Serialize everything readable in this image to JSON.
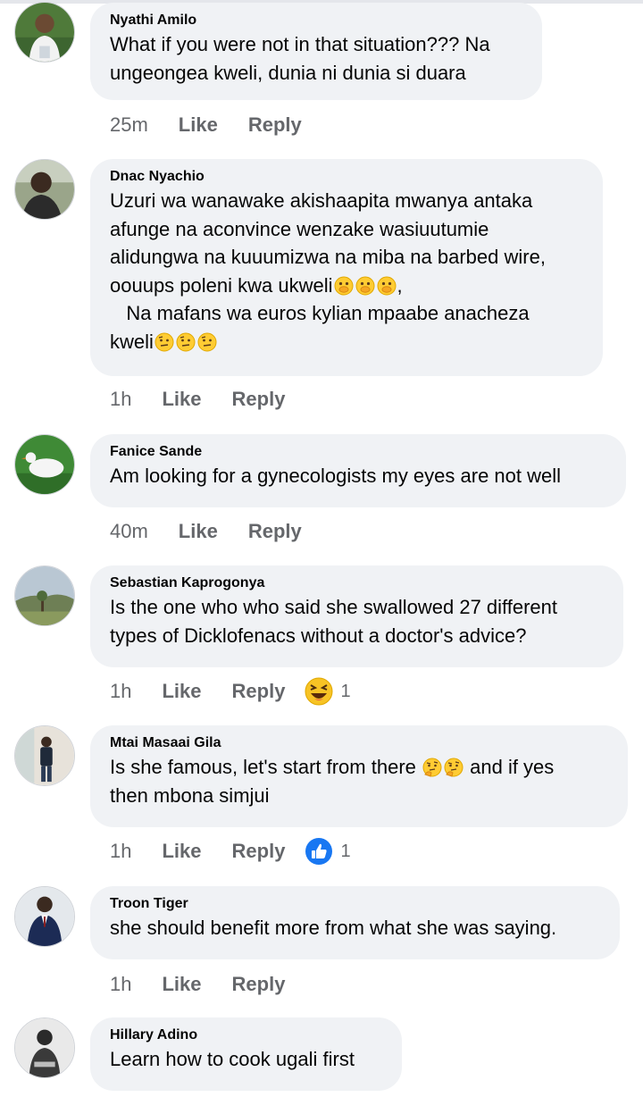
{
  "colors": {
    "bubble": "#f0f2f5",
    "meta_text": "#65676b",
    "like_blue": "#1877f2"
  },
  "comments": [
    {
      "name": "Nyathi Amilo",
      "text": "What if you were not in that situation??? Na\nungeongea kweli, dunia ni dunia si duara",
      "time": "25m",
      "like": "Like",
      "reply": "Reply",
      "avatar_icon": "child-photo-avatar"
    },
    {
      "name": "Dnac Nyachio",
      "text_lines": [
        "Uzuri wa wanawake akishaapita mwanya antaka",
        "afunge na aconvince wenzake wasiuutumie",
        "alidungwa na kuuumizwa na miba na barbed wire,",
        "oouups poleni kwa ukweli",
        "   Na mafans wa euros kylian mpaabe anacheza",
        "kweli"
      ],
      "line4_suffix": ",",
      "time": "1h",
      "like": "Like",
      "reply": "Reply",
      "avatar_icon": "man-photo-avatar",
      "emojis": [
        "face-with-open-eyes-hand-over-mouth",
        "face-with-open-eyes-hand-over-mouth",
        "face-with-open-eyes-hand-over-mouth",
        "face-with-raised-eyebrow",
        "face-with-raised-eyebrow",
        "face-with-raised-eyebrow"
      ]
    },
    {
      "name": "Fanice Sande",
      "text": "Am looking for a gynecologists my eyes are not well",
      "time": "40m",
      "like": "Like",
      "reply": "Reply",
      "avatar_icon": "white-bird-avatar"
    },
    {
      "name": "Sebastian Kaprogonya",
      "text": "Is the one who who said she swallowed 27 different\ntypes of Dicklofenacs without a doctor's advice?",
      "time": "1h",
      "like": "Like",
      "reply": "Reply",
      "avatar_icon": "landscape-avatar",
      "reaction": {
        "icon": "laughing-face-icon",
        "count": "1"
      }
    },
    {
      "name": "Mtai Masaai Gila",
      "text_line1": "Is she famous, let's start from there",
      "text_line1_suffix": " and if yes",
      "text_line2": "then mbona simjui",
      "time": "1h",
      "like": "Like",
      "reply": "Reply",
      "avatar_icon": "standing-man-avatar",
      "emojis": [
        "thinking-face",
        "thinking-face"
      ],
      "reaction": {
        "icon": "thumbs-up-icon",
        "count": "1"
      }
    },
    {
      "name": "Troon Tiger",
      "text": "she should benefit more from what she was saying.",
      "time": "1h",
      "like": "Like",
      "reply": "Reply",
      "avatar_icon": "man-in-suit-avatar"
    },
    {
      "name": "Hillary Adino",
      "text": "Learn how to cook ugali first",
      "avatar_icon": "bw-portrait-avatar"
    }
  ]
}
